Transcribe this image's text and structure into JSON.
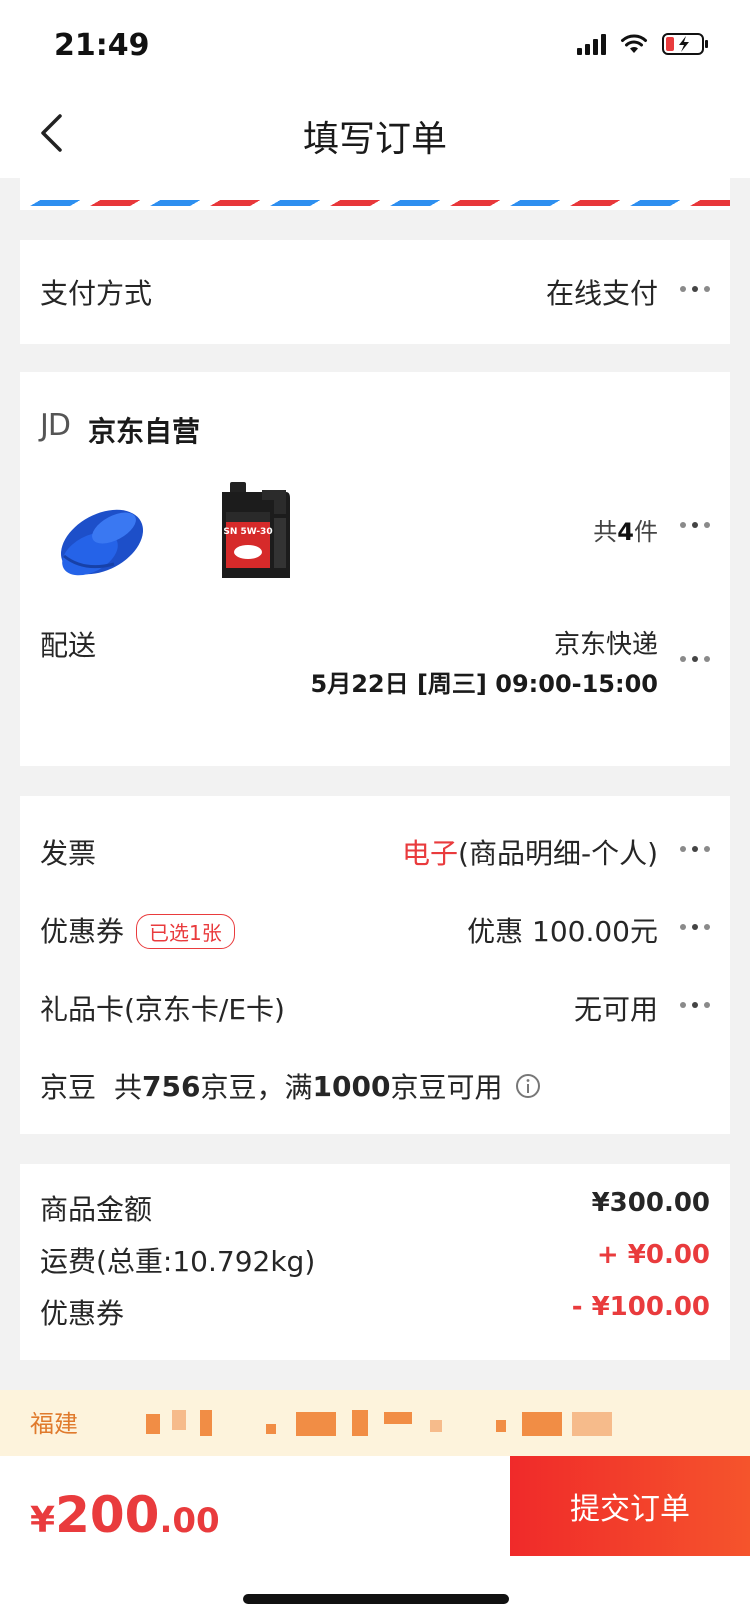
{
  "status_bar": {
    "time": "21:49"
  },
  "nav": {
    "title": "填写订单"
  },
  "payment": {
    "label": "支付方式",
    "value": "在线支付"
  },
  "shop": {
    "logo": "JD",
    "name": "京东自营",
    "item_count_prefix": "共",
    "item_count": "4",
    "item_count_suffix": "件",
    "products": [
      {
        "name": "blue-microfiber-towel"
      },
      {
        "name": "engine-oil-can",
        "label": "SN 5W-30"
      }
    ]
  },
  "delivery": {
    "label": "配送",
    "carrier": "京东快递",
    "time_slot": "5月22日 [周三] 09:00-15:00"
  },
  "invoice": {
    "label": "发票",
    "type": "电子",
    "detail": "(商品明细-个人)"
  },
  "coupon": {
    "label": "优惠券",
    "badge": "已选1张",
    "value": "优惠 100.00元"
  },
  "gift_card": {
    "label": "礼品卡(京东卡/E卡)",
    "value": "无可用"
  },
  "jd_beans": {
    "label": "京豆",
    "text_1": "共",
    "total": "756",
    "text_2": "京豆，满",
    "threshold": "1000",
    "text_3": "京豆可用"
  },
  "summary": {
    "goods_label": "商品金额",
    "goods_value": "¥300.00",
    "shipping_label": "运费(总重:10.792kg)",
    "shipping_value": "+ ¥0.00",
    "coupon_label": "优惠券",
    "coupon_value": "- ¥100.00"
  },
  "address": {
    "province": "福建"
  },
  "footer": {
    "currency": "¥",
    "total_int": "200",
    "total_dec": ".00",
    "submit_label": "提交订单"
  },
  "colors": {
    "accent": "#e93b3d",
    "banner_bg": "#fdf3dc",
    "page_bg": "#f2f2f2"
  }
}
